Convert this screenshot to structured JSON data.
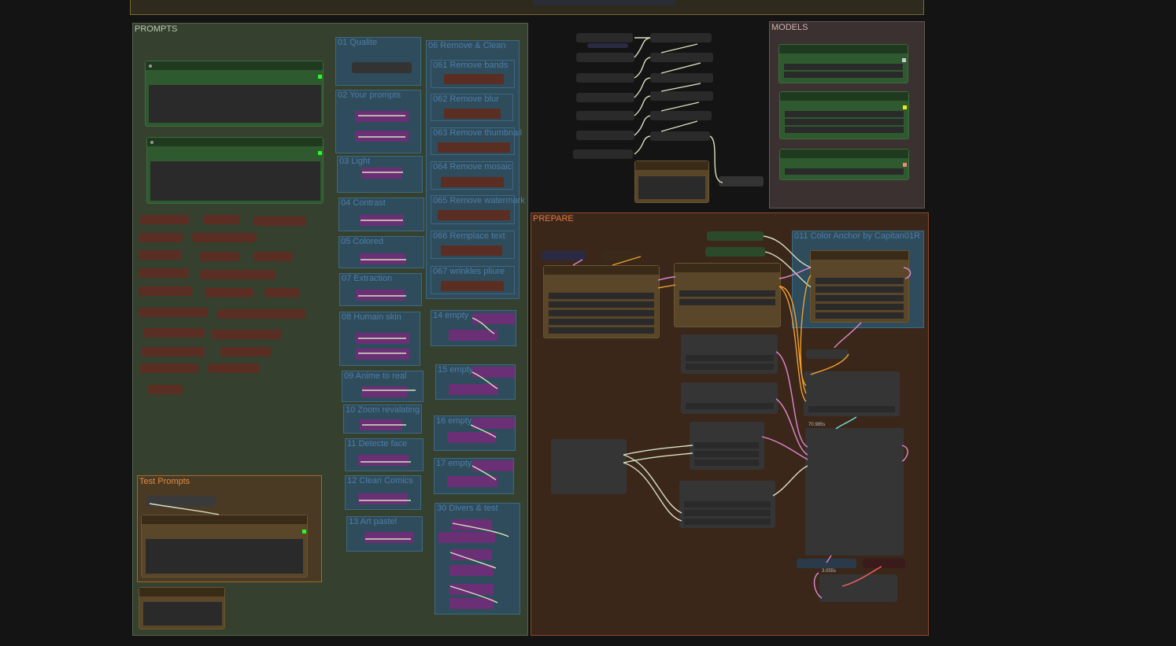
{
  "groups": {
    "prompts": {
      "title": "PROMPTS"
    },
    "models": {
      "title": "MODELS"
    },
    "prepare": {
      "title": "PREPARE"
    },
    "test_prompts": {
      "title": "Test Prompts"
    }
  },
  "subgroups": {
    "g01": "01 Qualite",
    "g02": "02 Your prompts",
    "g03": "03 Light",
    "g04": "04 Contrast",
    "g05": "05 Colored",
    "g06": "06 Remove & Clean",
    "g061": "061 Remove bands",
    "g062": "062 Remove blur",
    "g063": "063 Remove thumbnail",
    "g064": "064 Remove mosaic",
    "g065": "065 Remove watermark",
    "g066": "066 Remplace text",
    "g067": "067 wrinkles pliure",
    "g07": "07 Extraction",
    "g08": "08 Humain skin",
    "g09": "09 Anime to real",
    "g10": "10 Zoom revalating",
    "g11": "11 Detecte face",
    "g12": "12 Clean Comics",
    "g13": "13 Art pastel",
    "g14": "14 empty",
    "g15": "15 empty",
    "g16": "16 empty",
    "g17": "17 empty",
    "g30": "30 Divers & test",
    "g011": "011 Color Anchor by Capitan01R"
  },
  "readouts": {
    "time1": "70.985s",
    "time2": "3.055s"
  },
  "colors": {
    "background": "#141414",
    "prompts_group": "#35402f",
    "models_group": "#3b3131",
    "prepare_group": "#3a271a",
    "blue_group": "#2f4c5c",
    "green_node": "#2f5a2f",
    "brown_node": "#5a4628",
    "purple_node": "#6a2f75",
    "wire_orange": "#f0a030",
    "wire_pink": "#e088d0",
    "wire_pale": "#d8e0c0",
    "wire_cyan": "#6fe0e0"
  }
}
